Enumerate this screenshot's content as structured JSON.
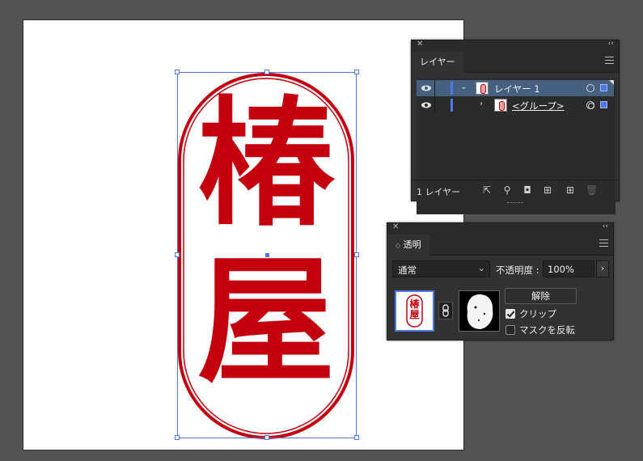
{
  "artwork": {
    "char_top": "椿",
    "char_bottom": "屋",
    "stamp_color": "#c4000f"
  },
  "selection_color": "#4d78e6",
  "layers_panel": {
    "tab_label": "レイヤー",
    "layers": [
      {
        "name": "レイヤー 1",
        "expanded": true,
        "selected": true
      },
      {
        "name": "<グループ>",
        "expanded": false,
        "selected": false
      }
    ],
    "footer_count": "1 レイヤー",
    "footer_icons": [
      "export-icon",
      "locate-object-icon",
      "clipping-mask-icon",
      "new-sublayer-icon",
      "new-layer-icon",
      "delete-icon"
    ]
  },
  "transparency_panel": {
    "tab_label": "透明",
    "blend_mode": "通常",
    "opacity_label": "不透明度 :",
    "opacity_value": "100%",
    "thumb_text_top": "椿",
    "thumb_text_bottom": "屋",
    "release_label": "解除",
    "clip_label": "クリップ",
    "clip_checked": true,
    "invert_label": "マスクを反転",
    "invert_checked": false
  }
}
